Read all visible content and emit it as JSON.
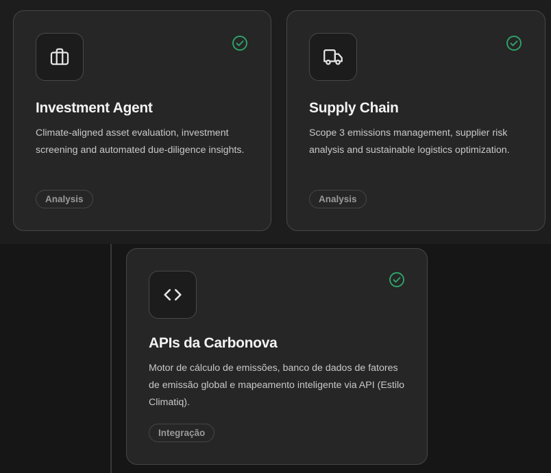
{
  "cards": [
    {
      "icon": "briefcase-icon",
      "title": "Investment Agent",
      "description": "Climate-aligned asset evaluation, investment screening and automated due-diligence insights.",
      "tag": "Analysis",
      "status": "enabled"
    },
    {
      "icon": "truck-icon",
      "title": "Supply Chain",
      "description": "Scope 3 emissions management, supplier risk analysis and sustainable logistics optimization.",
      "tag": "Analysis",
      "status": "enabled"
    },
    {
      "icon": "code-icon",
      "title": "APIs da Carbonova",
      "description": "Motor de cálculo de emissões, banco de dados de fatores de emissão global e mapeamento inteligente via API (Estilo Climatiq).",
      "tag": "Integração",
      "status": "enabled"
    }
  ],
  "colors": {
    "card_bg": "#262626",
    "card_border": "#474747",
    "check_green": "#2fa36b",
    "title_text": "#f3f3f3",
    "desc_text": "#c9c9c9",
    "tag_text": "#9a9a9a"
  }
}
